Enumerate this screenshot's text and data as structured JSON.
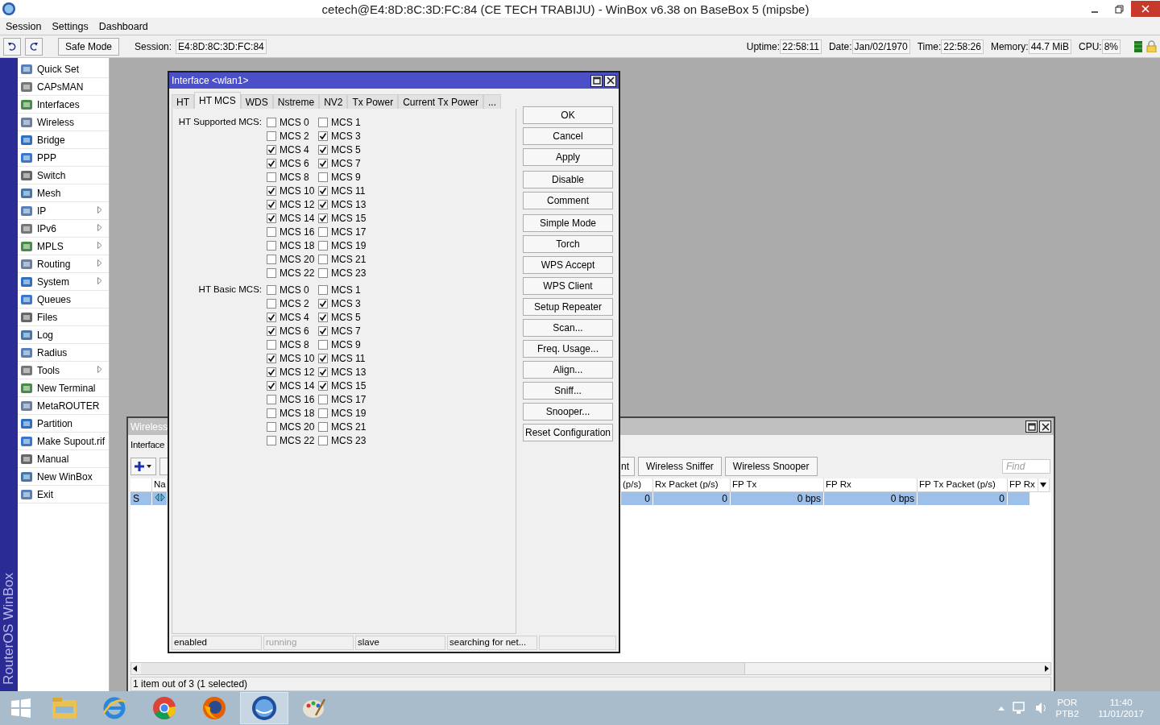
{
  "window": {
    "title": "cetech@E4:8D:8C:3D:FC:84 (CE TECH TRABIJU) - WinBox v6.38 on BaseBox 5 (mipsbe)"
  },
  "menu": [
    "Session",
    "Settings",
    "Dashboard"
  ],
  "toolbar": {
    "safe_mode": "Safe Mode",
    "session_label": "Session:",
    "session_value": "E4:8D:8C:3D:FC:84",
    "stats": [
      {
        "label": "Uptime:",
        "value": "22:58:11"
      },
      {
        "label": "Date:",
        "value": "Jan/02/1970"
      },
      {
        "label": "Time:",
        "value": "22:58:26"
      },
      {
        "label": "Memory:",
        "value": "44.7 MiB"
      },
      {
        "label": "CPU:",
        "value": "8%"
      }
    ]
  },
  "sidebar": {
    "brand": "RouterOS WinBox",
    "items": [
      {
        "label": "Quick Set",
        "submenu": false
      },
      {
        "label": "CAPsMAN",
        "submenu": false
      },
      {
        "label": "Interfaces",
        "submenu": false
      },
      {
        "label": "Wireless",
        "submenu": false
      },
      {
        "label": "Bridge",
        "submenu": false
      },
      {
        "label": "PPP",
        "submenu": false
      },
      {
        "label": "Switch",
        "submenu": false
      },
      {
        "label": "Mesh",
        "submenu": false
      },
      {
        "label": "IP",
        "submenu": true
      },
      {
        "label": "IPv6",
        "submenu": true
      },
      {
        "label": "MPLS",
        "submenu": true
      },
      {
        "label": "Routing",
        "submenu": true
      },
      {
        "label": "System",
        "submenu": true
      },
      {
        "label": "Queues",
        "submenu": false
      },
      {
        "label": "Files",
        "submenu": false
      },
      {
        "label": "Log",
        "submenu": false
      },
      {
        "label": "Radius",
        "submenu": false
      },
      {
        "label": "Tools",
        "submenu": true
      },
      {
        "label": "New Terminal",
        "submenu": false
      },
      {
        "label": "MetaROUTER",
        "submenu": false
      },
      {
        "label": "Partition",
        "submenu": false
      },
      {
        "label": "Make Supout.rif",
        "submenu": false
      },
      {
        "label": "Manual",
        "submenu": false
      },
      {
        "label": "New WinBox",
        "submenu": false
      },
      {
        "label": "Exit",
        "submenu": false
      }
    ]
  },
  "tables_window": {
    "title": "Wireless",
    "tabs": [
      "Interface"
    ],
    "partial_button": "nt",
    "buttons": [
      "Wireless Sniffer",
      "Wireless Snooper"
    ],
    "find_placeholder": "Find",
    "columns_left": [
      "Na"
    ],
    "columns_right": [
      "(p/s)",
      "Rx Packet (p/s)",
      "FP Tx",
      "FP Rx",
      "FP Tx Packet (p/s)",
      "FP Rx"
    ],
    "rows": [
      {
        "selected": true,
        "flag": "S",
        "cells": [
          "0",
          "0",
          "0 bps",
          "0 bps",
          "0"
        ]
      }
    ],
    "status": "1 item out of 3 (1 selected)"
  },
  "interface_dialog": {
    "title": "Interface <wlan1>",
    "tabs": [
      {
        "label": "HT",
        "selected": false
      },
      {
        "label": "HT MCS",
        "selected": true
      },
      {
        "label": "WDS",
        "selected": false
      },
      {
        "label": "Nstreme",
        "selected": false
      },
      {
        "label": "NV2",
        "selected": false
      },
      {
        "label": "Tx Power",
        "selected": false
      },
      {
        "label": "Current Tx Power",
        "selected": false
      },
      {
        "label": "...",
        "selected": false
      }
    ],
    "groups": [
      {
        "label": "HT Supported MCS:",
        "options": [
          {
            "label": "MCS 0",
            "checked": false
          },
          {
            "label": "MCS 1",
            "checked": false
          },
          {
            "label": "MCS 2",
            "checked": false
          },
          {
            "label": "MCS 3",
            "checked": true
          },
          {
            "label": "MCS 4",
            "checked": true
          },
          {
            "label": "MCS 5",
            "checked": true
          },
          {
            "label": "MCS 6",
            "checked": true
          },
          {
            "label": "MCS 7",
            "checked": true
          },
          {
            "label": "MCS 8",
            "checked": false
          },
          {
            "label": "MCS 9",
            "checked": false
          },
          {
            "label": "MCS 10",
            "checked": true
          },
          {
            "label": "MCS 11",
            "checked": true
          },
          {
            "label": "MCS 12",
            "checked": true
          },
          {
            "label": "MCS 13",
            "checked": true
          },
          {
            "label": "MCS 14",
            "checked": true
          },
          {
            "label": "MCS 15",
            "checked": true
          },
          {
            "label": "MCS 16",
            "checked": false
          },
          {
            "label": "MCS 17",
            "checked": false
          },
          {
            "label": "MCS 18",
            "checked": false
          },
          {
            "label": "MCS 19",
            "checked": false
          },
          {
            "label": "MCS 20",
            "checked": false
          },
          {
            "label": "MCS 21",
            "checked": false
          },
          {
            "label": "MCS 22",
            "checked": false
          },
          {
            "label": "MCS 23",
            "checked": false
          }
        ]
      },
      {
        "label": "HT Basic MCS:",
        "options": [
          {
            "label": "MCS 0",
            "checked": false
          },
          {
            "label": "MCS 1",
            "checked": false
          },
          {
            "label": "MCS 2",
            "checked": false
          },
          {
            "label": "MCS 3",
            "checked": true
          },
          {
            "label": "MCS 4",
            "checked": true
          },
          {
            "label": "MCS 5",
            "checked": true
          },
          {
            "label": "MCS 6",
            "checked": true
          },
          {
            "label": "MCS 7",
            "checked": true
          },
          {
            "label": "MCS 8",
            "checked": false
          },
          {
            "label": "MCS 9",
            "checked": false
          },
          {
            "label": "MCS 10",
            "checked": true
          },
          {
            "label": "MCS 11",
            "checked": true
          },
          {
            "label": "MCS 12",
            "checked": true
          },
          {
            "label": "MCS 13",
            "checked": true
          },
          {
            "label": "MCS 14",
            "checked": true
          },
          {
            "label": "MCS 15",
            "checked": true
          },
          {
            "label": "MCS 16",
            "checked": false
          },
          {
            "label": "MCS 17",
            "checked": false
          },
          {
            "label": "MCS 18",
            "checked": false
          },
          {
            "label": "MCS 19",
            "checked": false
          },
          {
            "label": "MCS 20",
            "checked": false
          },
          {
            "label": "MCS 21",
            "checked": false
          },
          {
            "label": "MCS 22",
            "checked": false
          },
          {
            "label": "MCS 23",
            "checked": false
          }
        ]
      }
    ],
    "button_groups": [
      [
        "OK",
        "Cancel",
        "Apply"
      ],
      [
        "Disable",
        "Comment"
      ],
      [
        "Simple Mode",
        "Torch",
        "WPS Accept",
        "WPS Client",
        "Setup Repeater",
        "Scan...",
        "Freq. Usage...",
        "Align...",
        "Sniff...",
        "Snooper...",
        "Reset Configuration"
      ]
    ],
    "status": [
      {
        "text": "enabled",
        "disabled": false
      },
      {
        "text": "running",
        "disabled": true
      },
      {
        "text": "slave",
        "disabled": false
      },
      {
        "text": "searching for net...",
        "disabled": false
      }
    ]
  },
  "taskbar": {
    "apps": [
      {
        "kind": "folder",
        "selected": false
      },
      {
        "kind": "ie",
        "selected": false
      },
      {
        "kind": "chrome",
        "selected": false
      },
      {
        "kind": "firefox",
        "selected": false
      },
      {
        "kind": "winbox",
        "selected": true
      },
      {
        "kind": "paint",
        "selected": false
      }
    ],
    "language": "POR",
    "layout": "PTB2",
    "time": "11:40",
    "date": "11/01/2017"
  }
}
